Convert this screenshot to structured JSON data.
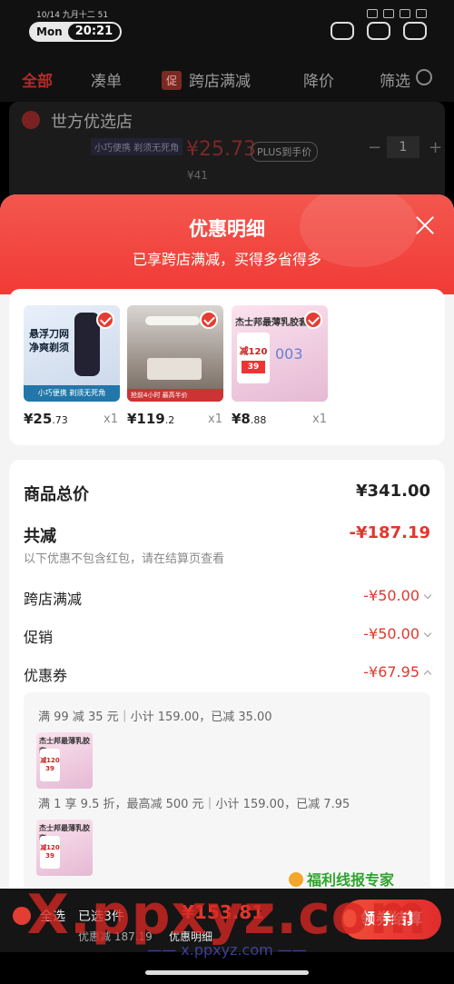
{
  "status": {
    "date": "10/14  九月十二  51",
    "day": "Mon",
    "time": "20:21"
  },
  "tabs": {
    "all": "全部",
    "bundle": "凑单",
    "promo_badge": "促",
    "cross_store": "跨店满减",
    "price_drop": "降价",
    "filter": "筛选"
  },
  "store": {
    "name": "世方优选店",
    "tag": "小巧便携 剃须无死角",
    "price": "¥25.73",
    "plus": "PLUS到手价",
    "qty": "1",
    "orig": "¥41"
  },
  "sheet": {
    "title": "优惠明细",
    "subtitle": "已享跨店满减，买得多省得多"
  },
  "products": [
    {
      "price_int": "¥25",
      "price_dec": ".73",
      "qty": "x1",
      "label": "悬浮刀网 净爽剃须",
      "foot": "小巧便携 剃须无死角"
    },
    {
      "price_int": "¥119",
      "price_dec": ".2",
      "qty": "x1",
      "foot": "抢前4小时 最高半价"
    },
    {
      "price_int": "¥8",
      "price_dec": ".88",
      "qty": "x1",
      "brand": "杰士邦最薄乳胶套",
      "box": "减120",
      "box2": "39",
      "logo": "003"
    }
  ],
  "summary": {
    "total_label": "商品总价",
    "total_value": "¥341.00",
    "reduce_label": "共减",
    "reduce_value": "-¥187.19",
    "note": "以下优惠不包含红包，请在结算页查看",
    "cross_label": "跨店满减",
    "cross_value": "-¥50.00",
    "promo_label": "促销",
    "promo_value": "-¥50.00",
    "coupon_label": "优惠券",
    "coupon_value": "-¥67.95"
  },
  "coupons": {
    "line1": "满 99 减 35 元｜小计 159.00，已减 35.00",
    "line2": "满 1 享 9.5 折，最高减 500 元｜小计 159.00，已减 7.95",
    "thumb_title": "杰士邦最薄乳胶套",
    "thumb_box": "减120 39"
  },
  "bottombar": {
    "select_all": "全选",
    "picked": "已选3件",
    "total": "¥153.81",
    "discount": "优惠减 187.19",
    "detail": "优惠明细",
    "checkout": "领券结算"
  },
  "watermarks": {
    "wm1": "福利线报专家",
    "wm2": "X.ppxyz.com",
    "wm3": "—— x.ppxyz.com ——"
  }
}
